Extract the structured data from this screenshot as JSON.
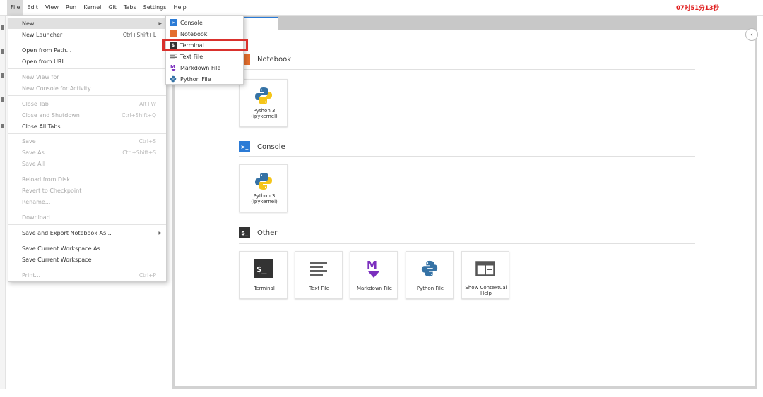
{
  "menubar": {
    "items": [
      "File",
      "Edit",
      "View",
      "Run",
      "Kernel",
      "Git",
      "Tabs",
      "Settings",
      "Help"
    ],
    "clock": "07时51分13秒"
  },
  "file_menu": {
    "items": [
      {
        "label": "New",
        "shortcut": "",
        "disabled": false,
        "submenu": true
      },
      {
        "label": "New Launcher",
        "shortcut": "Ctrl+Shift+L",
        "disabled": false
      },
      {
        "label": "Open from Path...",
        "shortcut": "",
        "disabled": false
      },
      {
        "label": "Open from URL...",
        "shortcut": "",
        "disabled": false
      },
      {
        "label": "New View for",
        "shortcut": "",
        "disabled": true
      },
      {
        "label": "New Console for Activity",
        "shortcut": "",
        "disabled": true
      },
      {
        "label": "Close Tab",
        "shortcut": "Alt+W",
        "disabled": true
      },
      {
        "label": "Close and Shutdown",
        "shortcut": "Ctrl+Shift+Q",
        "disabled": true
      },
      {
        "label": "Close All Tabs",
        "shortcut": "",
        "disabled": false
      },
      {
        "label": "Save",
        "shortcut": "Ctrl+S",
        "disabled": true
      },
      {
        "label": "Save As...",
        "shortcut": "Ctrl+Shift+S",
        "disabled": true
      },
      {
        "label": "Save All",
        "shortcut": "",
        "disabled": true
      },
      {
        "label": "Reload from Disk",
        "shortcut": "",
        "disabled": true
      },
      {
        "label": "Revert to Checkpoint",
        "shortcut": "",
        "disabled": true
      },
      {
        "label": "Rename...",
        "shortcut": "",
        "disabled": true
      },
      {
        "label": "Download",
        "shortcut": "",
        "disabled": true
      },
      {
        "label": "Save and Export Notebook As...",
        "shortcut": "",
        "disabled": false,
        "submenu": true
      },
      {
        "label": "Save Current Workspace As...",
        "shortcut": "",
        "disabled": false
      },
      {
        "label": "Save Current Workspace",
        "shortcut": "",
        "disabled": false
      },
      {
        "label": "Print...",
        "shortcut": "Ctrl+P",
        "disabled": true
      }
    ]
  },
  "new_submenu": {
    "items": [
      {
        "label": "Console",
        "icon": "console-icon",
        "color": "#2b7bd6"
      },
      {
        "label": "Notebook",
        "icon": "notebook-icon",
        "color": "#e46e2e"
      },
      {
        "label": "Terminal",
        "icon": "terminal-icon",
        "color": "#333333"
      },
      {
        "label": "Text File",
        "icon": "text-file-icon",
        "color": "#616161"
      },
      {
        "label": "Markdown File",
        "icon": "markdown-icon",
        "color": "#7b2fbe"
      },
      {
        "label": "Python File",
        "icon": "python-icon",
        "color": "#3572a5"
      }
    ],
    "highlighted": "Terminal",
    "highlight_color": "#d9312d"
  },
  "launcher": {
    "sections": {
      "notebook": {
        "title": "Notebook",
        "cards": [
          {
            "label": "Python 3\n(ipykernel)"
          }
        ]
      },
      "console": {
        "title": "Console",
        "cards": [
          {
            "label": "Python 3\n(ipykernel)"
          }
        ]
      },
      "other": {
        "title": "Other",
        "cards": [
          {
            "label": "Terminal"
          },
          {
            "label": "Text File"
          },
          {
            "label": "Markdown File"
          },
          {
            "label": "Python File"
          },
          {
            "label": "Show Contextual\nHelp"
          }
        ]
      }
    }
  },
  "colors": {
    "accent": "#2b7bd6",
    "notebook_orange": "#e46e2e",
    "markdown_purple": "#7b2fbe",
    "clock_red": "#e02020"
  }
}
